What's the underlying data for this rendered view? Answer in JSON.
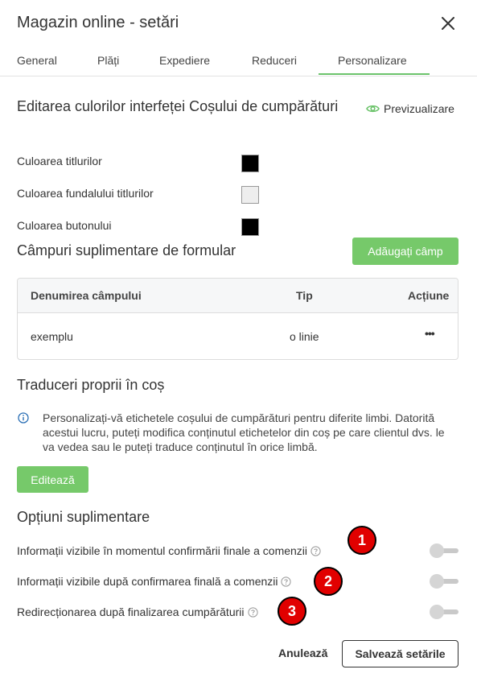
{
  "header": {
    "title": "Magazin online - setări"
  },
  "tabs": [
    {
      "label": "General"
    },
    {
      "label": "Plăți"
    },
    {
      "label": "Expediere"
    },
    {
      "label": "Reduceri"
    },
    {
      "label": "Personalizare",
      "active": true
    }
  ],
  "colors_section": {
    "title": "Editarea culorilor interfeței Coșului de cumpărături",
    "preview_label": "Previzualizare",
    "rows": [
      {
        "label": "Culoarea titlurilor",
        "color": "#000000"
      },
      {
        "label": "Culoarea fundalului titlurilor",
        "color": "#eeeeee"
      },
      {
        "label": "Culoarea butonului",
        "color": "#000000"
      }
    ]
  },
  "fields_section": {
    "title": "Câmpuri suplimentare de formular",
    "add_button": "Adăugați câmp",
    "columns": [
      "Denumirea câmpului",
      "Tip",
      "Acțiune"
    ],
    "rows": [
      {
        "name": "exemplu",
        "type": "o linie",
        "action": "•••"
      }
    ]
  },
  "translations_section": {
    "title": "Traduceri proprii în coș",
    "info": "Personalizați-vă etichetele coșului de cumpărături pentru diferite limbi. Datorită acestui lucru, puteți modifica conținutul etichetelor din coș pe care clientul dvs. le va vedea sau le puteți traduce conținutul în orice limbă.",
    "edit_button": "Editează"
  },
  "options_section": {
    "title": "Opțiuni suplimentare",
    "items": [
      {
        "label": "Informații vizibile în momentul confirmării finale a comenzii",
        "enabled": false,
        "badge": "1"
      },
      {
        "label": "Informații vizibile după confirmarea finală a comenzii",
        "enabled": false,
        "badge": "2"
      },
      {
        "label": "Redirecționarea după finalizarea cumpărăturii",
        "enabled": false,
        "badge": "3"
      }
    ]
  },
  "footer": {
    "cancel": "Anulează",
    "save": "Salvează setările"
  },
  "colors": {
    "accent": "#6cc36b",
    "button_green": "#76c96a",
    "badge_red": "#e10000"
  }
}
